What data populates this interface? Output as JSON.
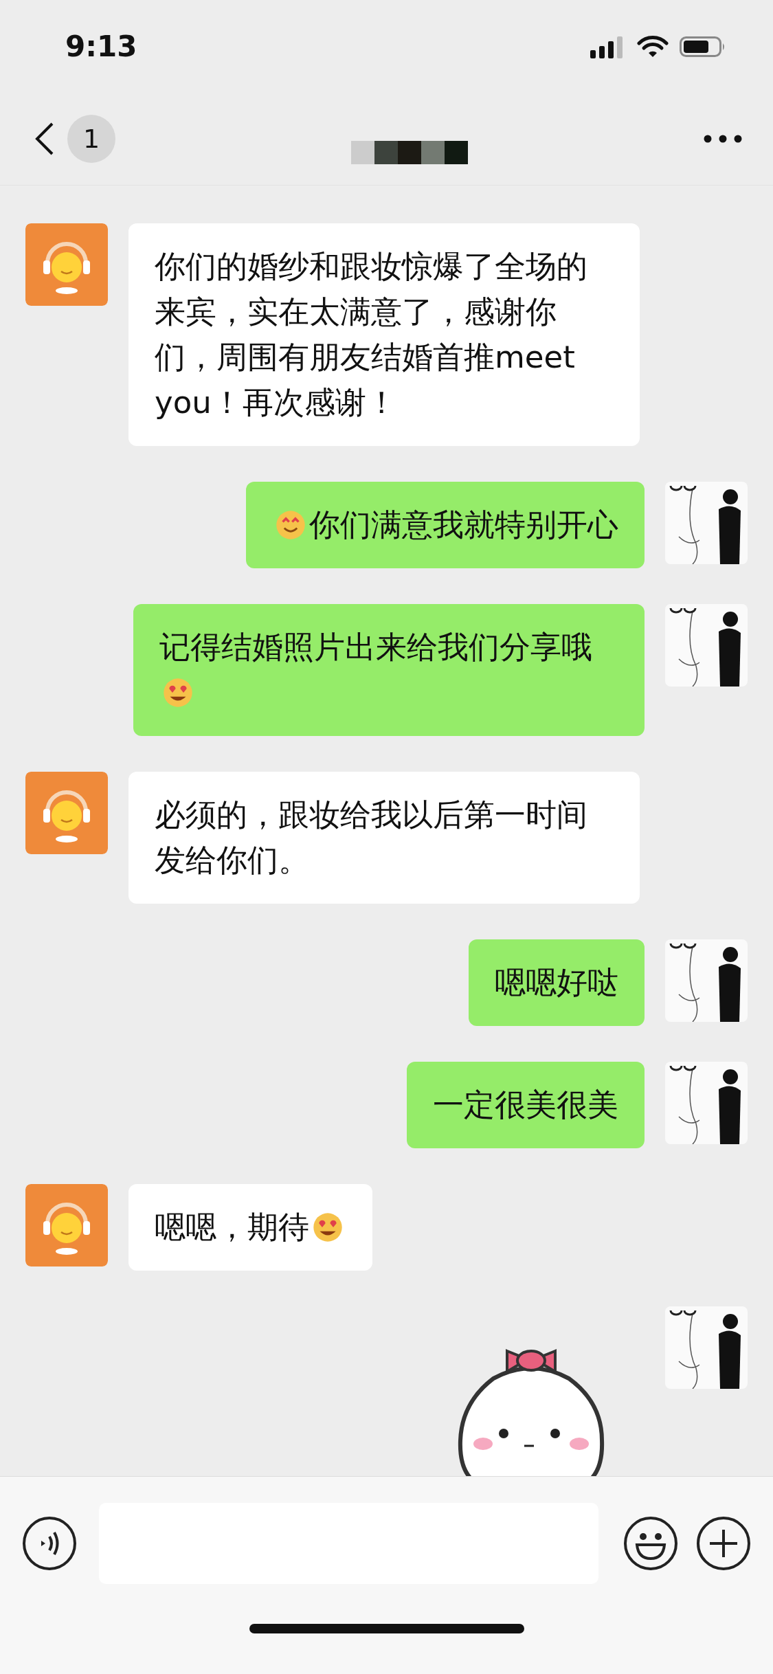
{
  "status_bar": {
    "time": "9:13"
  },
  "nav": {
    "unread_count": "1"
  },
  "messages": [
    {
      "kind": "received",
      "parts": [
        {
          "kind": "text",
          "text": "你们的婚纱和跟妆惊爆了全场的来宾，实在太满意了，感谢你们，周围有朋友结婚首推meet you！再次感谢！"
        }
      ]
    },
    {
      "kind": "sent",
      "parts": [
        {
          "kind": "smile_emoji"
        },
        {
          "kind": "text",
          "text": "你们满意我就特别开心"
        }
      ]
    },
    {
      "kind": "sent",
      "parts": [
        {
          "kind": "text",
          "text": "记得结婚照片出来给我们分享哦"
        },
        {
          "kind": "grin_emoji"
        }
      ]
    },
    {
      "kind": "received",
      "parts": [
        {
          "kind": "text",
          "text": "必须的，跟妆给我以后第一时间发给你们。"
        }
      ]
    },
    {
      "kind": "sent",
      "parts": [
        {
          "kind": "text",
          "text": "嗯嗯好哒"
        }
      ]
    },
    {
      "kind": "sent",
      "parts": [
        {
          "kind": "text",
          "text": "一定很美很美"
        }
      ]
    },
    {
      "kind": "received",
      "parts": [
        {
          "kind": "text",
          "text": "嗯嗯，期待"
        },
        {
          "kind": "grin_emoji"
        }
      ]
    },
    {
      "kind": "sent_sticker"
    }
  ]
}
